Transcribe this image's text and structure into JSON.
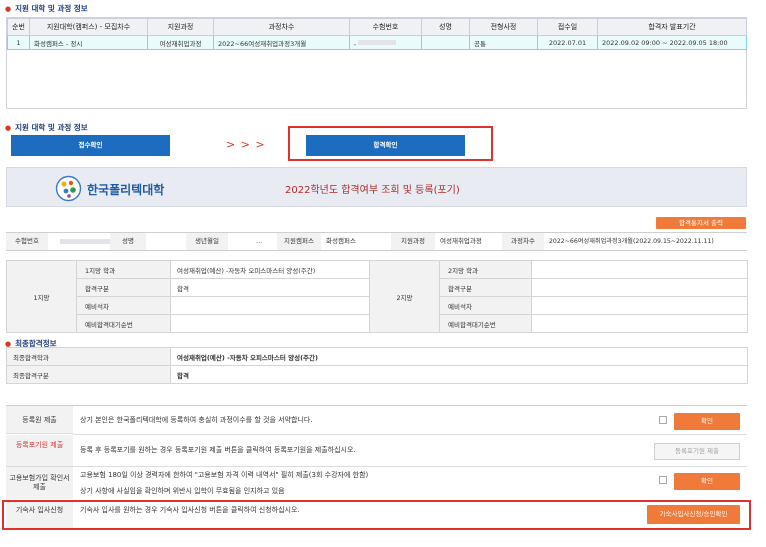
{
  "section1": {
    "title": "지원 대학 및 과정 정보"
  },
  "table1": {
    "headers": [
      "순번",
      "지원대학(캠퍼스) - 모집차수",
      "지원과정",
      "과정차수",
      "수험번호",
      "성명",
      "전형사정",
      "접수일",
      "합격자 발표기간"
    ],
    "row": {
      "no": "1",
      "campus": "화성캠퍼스 - 정시",
      "course": "여성재취업과정",
      "session": "2022~66여성재취업과정3개월",
      "exam_no": ",",
      "name": "",
      "screening": "공통",
      "date": "2022.07.01",
      "period": "2022.09.02 09:00 ~ 2022.09.05 18:00"
    }
  },
  "section2": {
    "title": "지원 대학 및 과정 정보"
  },
  "steps": {
    "receipt": "접수확인",
    "arrows": "> > >",
    "pass_check": "합격확인"
  },
  "banner": {
    "logo_text": "한국폴리텍대학",
    "title": "2022학년도 합격여부 조회 및 등록(포기)"
  },
  "print_button": "합격통지서 출력",
  "info": {
    "exam_no_label": "수험번호",
    "exam_no_value": "",
    "name_label": "성명",
    "name_value": "",
    "birth_label": "생년월일",
    "birth_value": "...",
    "campus_label": "지원캠퍼스",
    "campus_value": "화성캠퍼스",
    "course_label": "지원과정",
    "course_value": "여성재취업과정",
    "session_label": "과정차수",
    "session_value": "2022~66여성재취업과정3개월(2022.09.15~2022.11.11)"
  },
  "choices": {
    "first_label": "1지망",
    "second_label": "2지망",
    "rows": [
      {
        "label": "1지망 학과",
        "value": "여성재취업(예산) -자동차 오피스마스터 양성(주간)",
        "label2": "2지망 학과",
        "value2": ""
      },
      {
        "label": "합격구분",
        "value": "합격",
        "label2": "합격구분",
        "value2": ""
      },
      {
        "label": "예비석차",
        "value": "",
        "label2": "예비석차",
        "value2": ""
      },
      {
        "label": "예비합격대기순번",
        "value": "",
        "label2": "예비합격대기순번",
        "value2": ""
      }
    ]
  },
  "final": {
    "title": "최종합격정보",
    "dept_label": "최종합격학과",
    "dept_value": "여성재취업(예산) -자동차 오피스마스터 양성(주간)",
    "type_label": "최종합격구분",
    "type_value": "합격"
  },
  "actions": {
    "register_label": "등록원 제출",
    "register_text": "상기 본인은 한국폴리텍대학에 등록하여 충실히 과정이수를 할 것을 서약합니다.",
    "register_button": "확인",
    "giveup_label": "등록포기원 제출",
    "giveup_text": "등록 후 등록포기를 원하는 경우 등록포기원 제출 버튼을 클릭하여 등록포기원을 제출하십시오.",
    "giveup_button": "등록포기원 제출",
    "insurance_label": "고용보험가입 확인서 제출",
    "insurance_text1": "고용보험 180일 이상 경력자에 한하여 \"고용보험 자격 이력 내역서\" 필히 제출(3회 수강자에 한함)",
    "insurance_text2": "상기 사항에 사실임을 확인하며 위반시 입학이 무효됨을 인지하고 있음",
    "insurance_button": "확인",
    "dorm_label": "기숙사 입사신청",
    "dorm_text": "기숙사 입사를 원하는 경우 기숙사 입사신청 버튼을 클릭하여 신청하십시오.",
    "dorm_button": "기숙사입사신청/승인확인"
  },
  "colors": {
    "accent_blue": "#1c6cc0",
    "accent_orange": "#ef7a3a",
    "highlight_red": "#e03030",
    "title_red": "#b02a2a"
  }
}
